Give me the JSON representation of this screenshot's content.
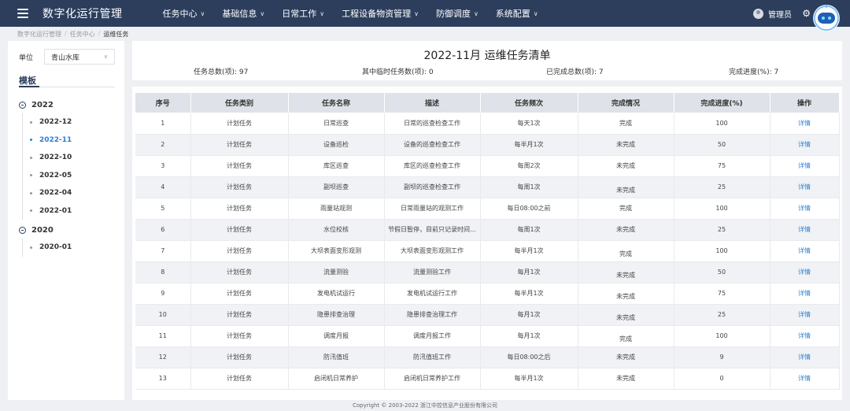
{
  "app": {
    "title": "数字化运行管理"
  },
  "nav": [
    {
      "label": "任务中心",
      "chevron": "chevron-down"
    },
    {
      "label": "基础信息",
      "chevron": "chevron-down"
    },
    {
      "label": "日常工作",
      "chevron": "chevron-down"
    },
    {
      "label": "工程设备物资管理",
      "chevron": "chevron-down"
    },
    {
      "label": "防御调度",
      "chevron": "chevron-down"
    },
    {
      "label": "系统配置",
      "chevron": "chevron-down"
    }
  ],
  "user": {
    "name": "管理员"
  },
  "breadcrumb": [
    "数字化运行管理",
    "任务中心",
    "运维任务"
  ],
  "left": {
    "unit_label": "单位",
    "unit_value": "青山水库",
    "template_title": "模板",
    "tree": [
      {
        "year": "2022",
        "months": [
          "2022-12",
          "2022-11",
          "2022-10",
          "2022-05",
          "2022-04",
          "2022-01"
        ],
        "active": "2022-11"
      },
      {
        "year": "2020",
        "months": [
          "2020-01"
        ],
        "active": ""
      }
    ]
  },
  "summary": {
    "title": "2022-11月 运维任务清单",
    "total": "任务总数(项): 97",
    "temp": "其中临时任务数(项): 0",
    "done": "已完成总数(项): 7",
    "progress": "完成进度(%): 7"
  },
  "table": {
    "headers": [
      "序号",
      "任务类别",
      "任务名称",
      "描述",
      "任务频次",
      "完成情况",
      "完成进度(%)",
      "操作"
    ],
    "rows": [
      [
        "1",
        "计划任务",
        "日常巡查",
        "日常的巡查检查工作",
        "每天1次",
        "完成",
        "100",
        "详情"
      ],
      [
        "2",
        "计划任务",
        "设备巡检",
        "设备的巡查检查工作",
        "每半月1次",
        "未完成",
        "50",
        "详情"
      ],
      [
        "3",
        "计划任务",
        "库区巡查",
        "库区的巡查检查工作",
        "每周2次",
        "未完成",
        "75",
        "详情"
      ],
      [
        "4",
        "计划任务",
        "副坝巡查",
        "副坝的巡查检查工作",
        "每周1次",
        "未完成",
        "25",
        "详情"
      ],
      [
        "5",
        "计划任务",
        "雨量站观测",
        "日常雨量站的观测工作",
        "每日08:00之前",
        "完成",
        "100",
        "详情"
      ],
      [
        "6",
        "计划任务",
        "水位校核",
        "节假日暂停，目前只记录时间…",
        "每周1次",
        "未完成",
        "25",
        "详情"
      ],
      [
        "7",
        "计划任务",
        "大坝表面变形观测",
        "大坝表面变形观测工作",
        "每半月1次",
        "完成",
        "100",
        "详情"
      ],
      [
        "8",
        "计划任务",
        "流量测验",
        "流量测验工作",
        "每月1次",
        "未完成",
        "50",
        "详情"
      ],
      [
        "9",
        "计划任务",
        "发电机试运行",
        "发电机试运行工作",
        "每半月1次",
        "未完成",
        "75",
        "详情"
      ],
      [
        "10",
        "计划任务",
        "隐患排查治理",
        "隐患排查治理工作",
        "每月1次",
        "未完成",
        "25",
        "详情"
      ],
      [
        "11",
        "计划任务",
        "调度月报",
        "调度月报工作",
        "每月1次",
        "完成",
        "100",
        "详情"
      ],
      [
        "12",
        "计划任务",
        "防汛值班",
        "防汛值班工作",
        "每日08:00之后",
        "未完成",
        "9",
        "详情"
      ],
      [
        "13",
        "计划任务",
        "启闭机日常养护",
        "启闭机日常养护工作",
        "每半月1次",
        "未完成",
        "0",
        "详情"
      ]
    ]
  },
  "footer": {
    "copyright": "Copyright © 2003-2022 浙江中控信息产业股份有限公司"
  },
  "colors": {
    "topbar": "#2c3e5c",
    "link": "#2c7fd4",
    "header_row": "#dfe2e8"
  }
}
